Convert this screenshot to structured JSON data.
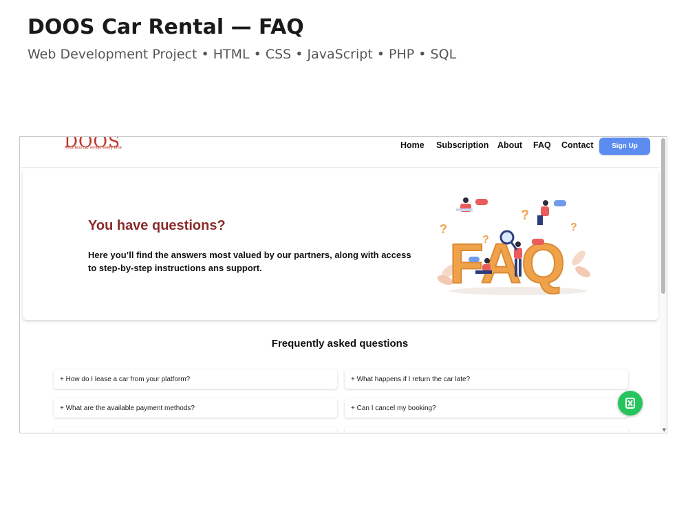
{
  "header": {
    "title": "DOOS Car Rental — FAQ",
    "subtitle": "Web Development Project • HTML • CSS • JavaScript • PHP • SQL"
  },
  "site": {
    "logo": "DOOS",
    "tagline": "effortless car rental, every time",
    "nav": [
      "Home",
      "Subscription",
      "About",
      "FAQ",
      "Contact"
    ],
    "signup_label": "Sign Up"
  },
  "hero": {
    "title": "You have questions?",
    "text": "Here you’ll find the answers most valued by our partners, along with access to step-by-step instructions ans support.",
    "art_label": "FAQ"
  },
  "faq": {
    "heading": "Frequently asked questions",
    "items": [
      "+ How do I lease a car from your platform?",
      "+ What happens if I return the car late?",
      "+ What are the available payment methods?",
      "+ Can I cancel my booking?"
    ]
  },
  "colors": {
    "brand": "#c0392b",
    "hero_title": "#8b2a2a",
    "signup": "#5c8cf0",
    "chat": "#25c55e"
  },
  "icons": [
    "whatsapp-icon"
  ]
}
